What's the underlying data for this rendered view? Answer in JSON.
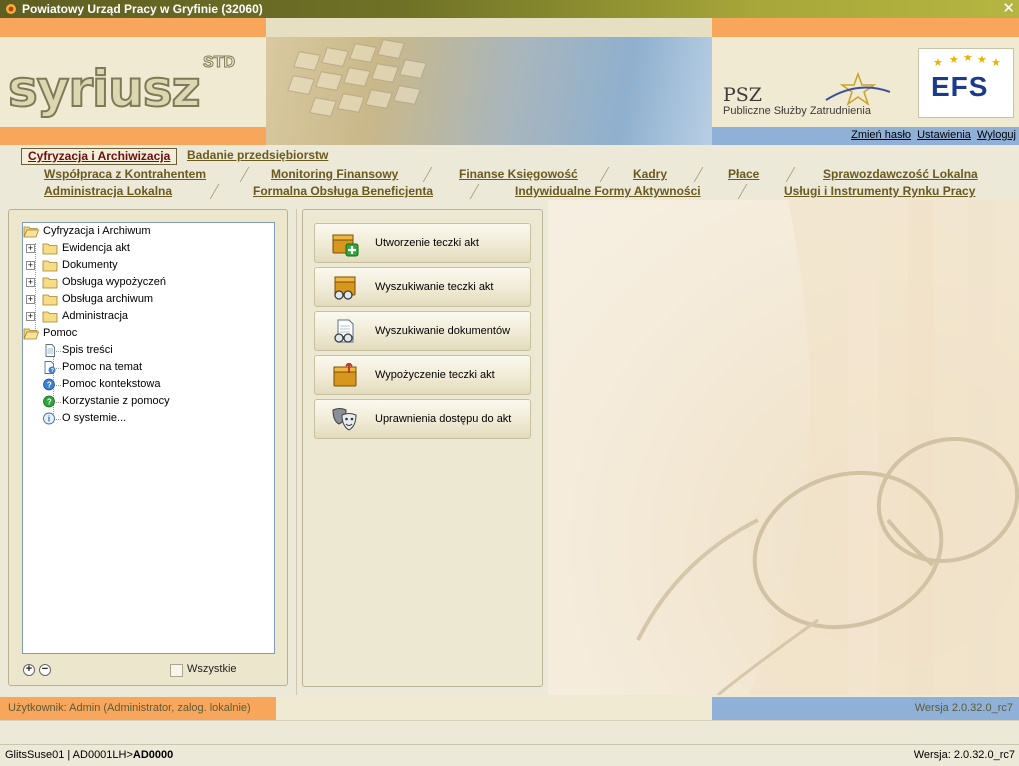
{
  "window": {
    "title": "Powiatowy Urząd Pracy w Gryfinie (32060)",
    "close_glyph": "✕"
  },
  "banner": {
    "logo_text": "syriusz",
    "logo_suffix": "STD",
    "psz_title": "PSZ",
    "psz_subtitle": "Publiczne Służby Zatrudnienia",
    "efs_logo": "EFS",
    "links": [
      "Zmień hasło",
      "Ustawienia",
      "Wyloguj"
    ]
  },
  "module_tabs": {
    "row1": [
      {
        "label": "Cyfryzacja i Archiwizacja",
        "active": true
      },
      {
        "label": "Badanie przedsiębiorstw",
        "active": false
      }
    ],
    "row2": [
      "Współpraca z Kontrahentem",
      "Monitoring Finansowy",
      "Finanse Księgowość",
      "Kadry",
      "Płace",
      "Sprawozdawczość Lokalna"
    ],
    "row3": [
      "Administracja Lokalna",
      "Formalna Obsługa Beneficjenta",
      "Indywidualne Formy Aktywności",
      "Usługi i Instrumenty Rynku Pracy"
    ]
  },
  "tree": {
    "nodes": [
      {
        "label": "Cyfryzacja i Archiwum",
        "icon": "folder-open-icon",
        "level": 0
      },
      {
        "label": "Ewidencja akt",
        "icon": "folder-icon",
        "level": 1
      },
      {
        "label": "Dokumenty",
        "icon": "folder-icon",
        "level": 1
      },
      {
        "label": "Obsługa wypożyczeń",
        "icon": "folder-icon",
        "level": 1
      },
      {
        "label": "Obsługa archiwum",
        "icon": "folder-icon",
        "level": 1
      },
      {
        "label": "Administracja",
        "icon": "folder-icon",
        "level": 1
      },
      {
        "label": "Pomoc",
        "icon": "folder-open-icon",
        "level": 0
      },
      {
        "label": "Spis treści",
        "icon": "document-icon",
        "level": 1
      },
      {
        "label": "Pomoc na temat",
        "icon": "help-document-icon",
        "level": 1
      },
      {
        "label": "Pomoc kontekstowa",
        "icon": "help-circle-icon",
        "level": 1
      },
      {
        "label": "Korzystanie z pomocy",
        "icon": "help-green-icon",
        "level": 1
      },
      {
        "label": "O systemie...",
        "icon": "info-icon",
        "level": 1
      }
    ],
    "expand_label": "+",
    "collapse_label": "−",
    "all_label": "Wszystkie",
    "all_checked": false
  },
  "actions": [
    {
      "label": "Utworzenie teczki akt",
      "icon": "folder-add-icon"
    },
    {
      "label": "Wyszukiwanie teczki akt",
      "icon": "folder-search-icon"
    },
    {
      "label": "Wyszukiwanie dokumentów",
      "icon": "document-search-icon"
    },
    {
      "label": "Wypożyczenie teczki akt",
      "icon": "folder-lend-icon"
    },
    {
      "label": "Uprawnienia dostępu do akt",
      "icon": "masks-icon"
    }
  ],
  "status": {
    "user": "Użytkownik: Admin (Administrator, zalog. lokalnie)",
    "version": "Wersja 2.0.32.0_rc7",
    "bottom_left_prefix": "GlitsSuse01 | AD0001LH>",
    "bottom_left_bold": "AD0000",
    "bottom_right": "Wersja: 2.0.32.0_rc7"
  },
  "colors": {
    "accent_orange": "#f7a65b",
    "accent_blue": "#8fb1d8",
    "tab_text": "#6a5a1e",
    "active_tab_text": "#6a1010"
  }
}
